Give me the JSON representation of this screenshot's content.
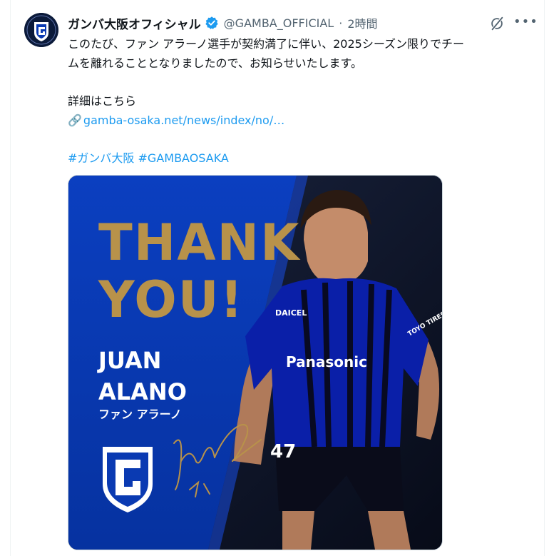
{
  "tweet": {
    "display_name": "ガンバ大阪オフィシャル",
    "handle": "@GAMBA_OFFICIAL",
    "separator": "·",
    "time": "2時間",
    "text_line1": "このたび、ファン アラーノ選手が契約満了に伴い、2025シーズン限りでチー",
    "text_line2": "ムを離れることとなりましたので、お知らせいたします。",
    "details_label": "詳細はこちら",
    "link_text": "gamba-osaka.net/news/index/no/…",
    "hashtag1": "#ガンバ大阪",
    "hashtag2": "#GAMBAOSAKA",
    "icons": {
      "verified": "verified-badge-icon",
      "grok": "grok-icon",
      "more": "more-options-icon",
      "link": "link-chain-icon"
    }
  },
  "media": {
    "thank_line1": "THANK",
    "thank_line2": "YOU!",
    "player_first": "JUAN",
    "player_last": "ALANO",
    "player_kana": "ファン アラーノ",
    "shirt_number": "47",
    "sponsor": "Panasonic",
    "jersey_brand": "DAICEL",
    "sleeve_sponsor": "TOYO TIRES",
    "signature": "Juan Alano 47",
    "colors": {
      "gold": "#b8924a",
      "blue": "#0a3ab2",
      "dark": "#0b1530"
    }
  },
  "colors": {
    "link": "#1d9bf0",
    "secondary": "#536471",
    "verified": "#1d9bf0"
  }
}
